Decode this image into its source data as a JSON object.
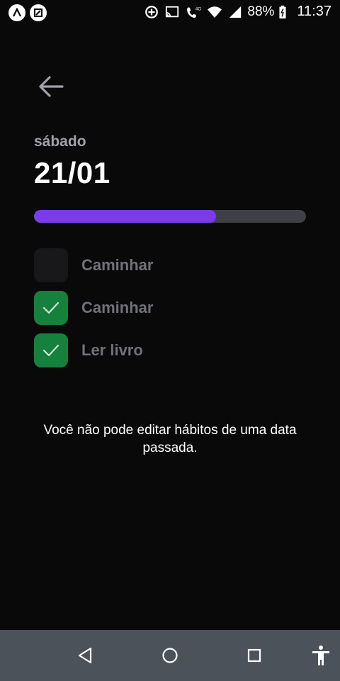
{
  "status_bar": {
    "battery": "88%",
    "time": "11:37",
    "network_label": "4G",
    "left_icons": [
      "expo-icon",
      "screenshot-icon"
    ],
    "right_icons": [
      "data-saver-icon",
      "cast-icon",
      "wifi-call-icon",
      "wifi-icon",
      "signal-icon",
      "battery-icon"
    ]
  },
  "header": {
    "back_icon": "arrow-left-icon",
    "weekday": "sábado",
    "date": "21/01"
  },
  "progress": {
    "value": 0.67,
    "color": "#7c3aed",
    "track_color": "#3f3f46"
  },
  "habits": [
    {
      "label": "Caminhar",
      "checked": false
    },
    {
      "label": "Caminhar",
      "checked": true
    },
    {
      "label": "Ler livro",
      "checked": true
    }
  ],
  "notice": "Você não pode editar hábitos de uma data passada.",
  "colors": {
    "background": "#09090a",
    "checked": "#16803d",
    "unchecked": "#18181b",
    "label": "#71717a"
  },
  "nav_bar": {
    "icons": [
      "back-triangle-icon",
      "home-circle-icon",
      "recents-square-icon",
      "accessibility-icon"
    ]
  }
}
